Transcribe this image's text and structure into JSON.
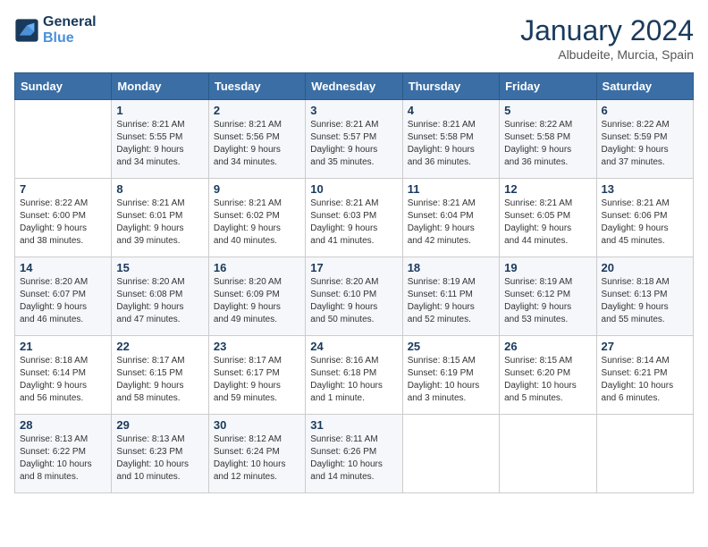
{
  "header": {
    "logo_line1": "General",
    "logo_line2": "Blue",
    "month": "January 2024",
    "location": "Albudeite, Murcia, Spain"
  },
  "weekdays": [
    "Sunday",
    "Monday",
    "Tuesday",
    "Wednesday",
    "Thursday",
    "Friday",
    "Saturday"
  ],
  "weeks": [
    [
      {
        "day": "",
        "info": ""
      },
      {
        "day": "1",
        "info": "Sunrise: 8:21 AM\nSunset: 5:55 PM\nDaylight: 9 hours\nand 34 minutes."
      },
      {
        "day": "2",
        "info": "Sunrise: 8:21 AM\nSunset: 5:56 PM\nDaylight: 9 hours\nand 34 minutes."
      },
      {
        "day": "3",
        "info": "Sunrise: 8:21 AM\nSunset: 5:57 PM\nDaylight: 9 hours\nand 35 minutes."
      },
      {
        "day": "4",
        "info": "Sunrise: 8:21 AM\nSunset: 5:58 PM\nDaylight: 9 hours\nand 36 minutes."
      },
      {
        "day": "5",
        "info": "Sunrise: 8:22 AM\nSunset: 5:58 PM\nDaylight: 9 hours\nand 36 minutes."
      },
      {
        "day": "6",
        "info": "Sunrise: 8:22 AM\nSunset: 5:59 PM\nDaylight: 9 hours\nand 37 minutes."
      }
    ],
    [
      {
        "day": "7",
        "info": "Sunrise: 8:22 AM\nSunset: 6:00 PM\nDaylight: 9 hours\nand 38 minutes."
      },
      {
        "day": "8",
        "info": "Sunrise: 8:21 AM\nSunset: 6:01 PM\nDaylight: 9 hours\nand 39 minutes."
      },
      {
        "day": "9",
        "info": "Sunrise: 8:21 AM\nSunset: 6:02 PM\nDaylight: 9 hours\nand 40 minutes."
      },
      {
        "day": "10",
        "info": "Sunrise: 8:21 AM\nSunset: 6:03 PM\nDaylight: 9 hours\nand 41 minutes."
      },
      {
        "day": "11",
        "info": "Sunrise: 8:21 AM\nSunset: 6:04 PM\nDaylight: 9 hours\nand 42 minutes."
      },
      {
        "day": "12",
        "info": "Sunrise: 8:21 AM\nSunset: 6:05 PM\nDaylight: 9 hours\nand 44 minutes."
      },
      {
        "day": "13",
        "info": "Sunrise: 8:21 AM\nSunset: 6:06 PM\nDaylight: 9 hours\nand 45 minutes."
      }
    ],
    [
      {
        "day": "14",
        "info": "Sunrise: 8:20 AM\nSunset: 6:07 PM\nDaylight: 9 hours\nand 46 minutes."
      },
      {
        "day": "15",
        "info": "Sunrise: 8:20 AM\nSunset: 6:08 PM\nDaylight: 9 hours\nand 47 minutes."
      },
      {
        "day": "16",
        "info": "Sunrise: 8:20 AM\nSunset: 6:09 PM\nDaylight: 9 hours\nand 49 minutes."
      },
      {
        "day": "17",
        "info": "Sunrise: 8:20 AM\nSunset: 6:10 PM\nDaylight: 9 hours\nand 50 minutes."
      },
      {
        "day": "18",
        "info": "Sunrise: 8:19 AM\nSunset: 6:11 PM\nDaylight: 9 hours\nand 52 minutes."
      },
      {
        "day": "19",
        "info": "Sunrise: 8:19 AM\nSunset: 6:12 PM\nDaylight: 9 hours\nand 53 minutes."
      },
      {
        "day": "20",
        "info": "Sunrise: 8:18 AM\nSunset: 6:13 PM\nDaylight: 9 hours\nand 55 minutes."
      }
    ],
    [
      {
        "day": "21",
        "info": "Sunrise: 8:18 AM\nSunset: 6:14 PM\nDaylight: 9 hours\nand 56 minutes."
      },
      {
        "day": "22",
        "info": "Sunrise: 8:17 AM\nSunset: 6:15 PM\nDaylight: 9 hours\nand 58 minutes."
      },
      {
        "day": "23",
        "info": "Sunrise: 8:17 AM\nSunset: 6:17 PM\nDaylight: 9 hours\nand 59 minutes."
      },
      {
        "day": "24",
        "info": "Sunrise: 8:16 AM\nSunset: 6:18 PM\nDaylight: 10 hours\nand 1 minute."
      },
      {
        "day": "25",
        "info": "Sunrise: 8:15 AM\nSunset: 6:19 PM\nDaylight: 10 hours\nand 3 minutes."
      },
      {
        "day": "26",
        "info": "Sunrise: 8:15 AM\nSunset: 6:20 PM\nDaylight: 10 hours\nand 5 minutes."
      },
      {
        "day": "27",
        "info": "Sunrise: 8:14 AM\nSunset: 6:21 PM\nDaylight: 10 hours\nand 6 minutes."
      }
    ],
    [
      {
        "day": "28",
        "info": "Sunrise: 8:13 AM\nSunset: 6:22 PM\nDaylight: 10 hours\nand 8 minutes."
      },
      {
        "day": "29",
        "info": "Sunrise: 8:13 AM\nSunset: 6:23 PM\nDaylight: 10 hours\nand 10 minutes."
      },
      {
        "day": "30",
        "info": "Sunrise: 8:12 AM\nSunset: 6:24 PM\nDaylight: 10 hours\nand 12 minutes."
      },
      {
        "day": "31",
        "info": "Sunrise: 8:11 AM\nSunset: 6:26 PM\nDaylight: 10 hours\nand 14 minutes."
      },
      {
        "day": "",
        "info": ""
      },
      {
        "day": "",
        "info": ""
      },
      {
        "day": "",
        "info": ""
      }
    ]
  ]
}
